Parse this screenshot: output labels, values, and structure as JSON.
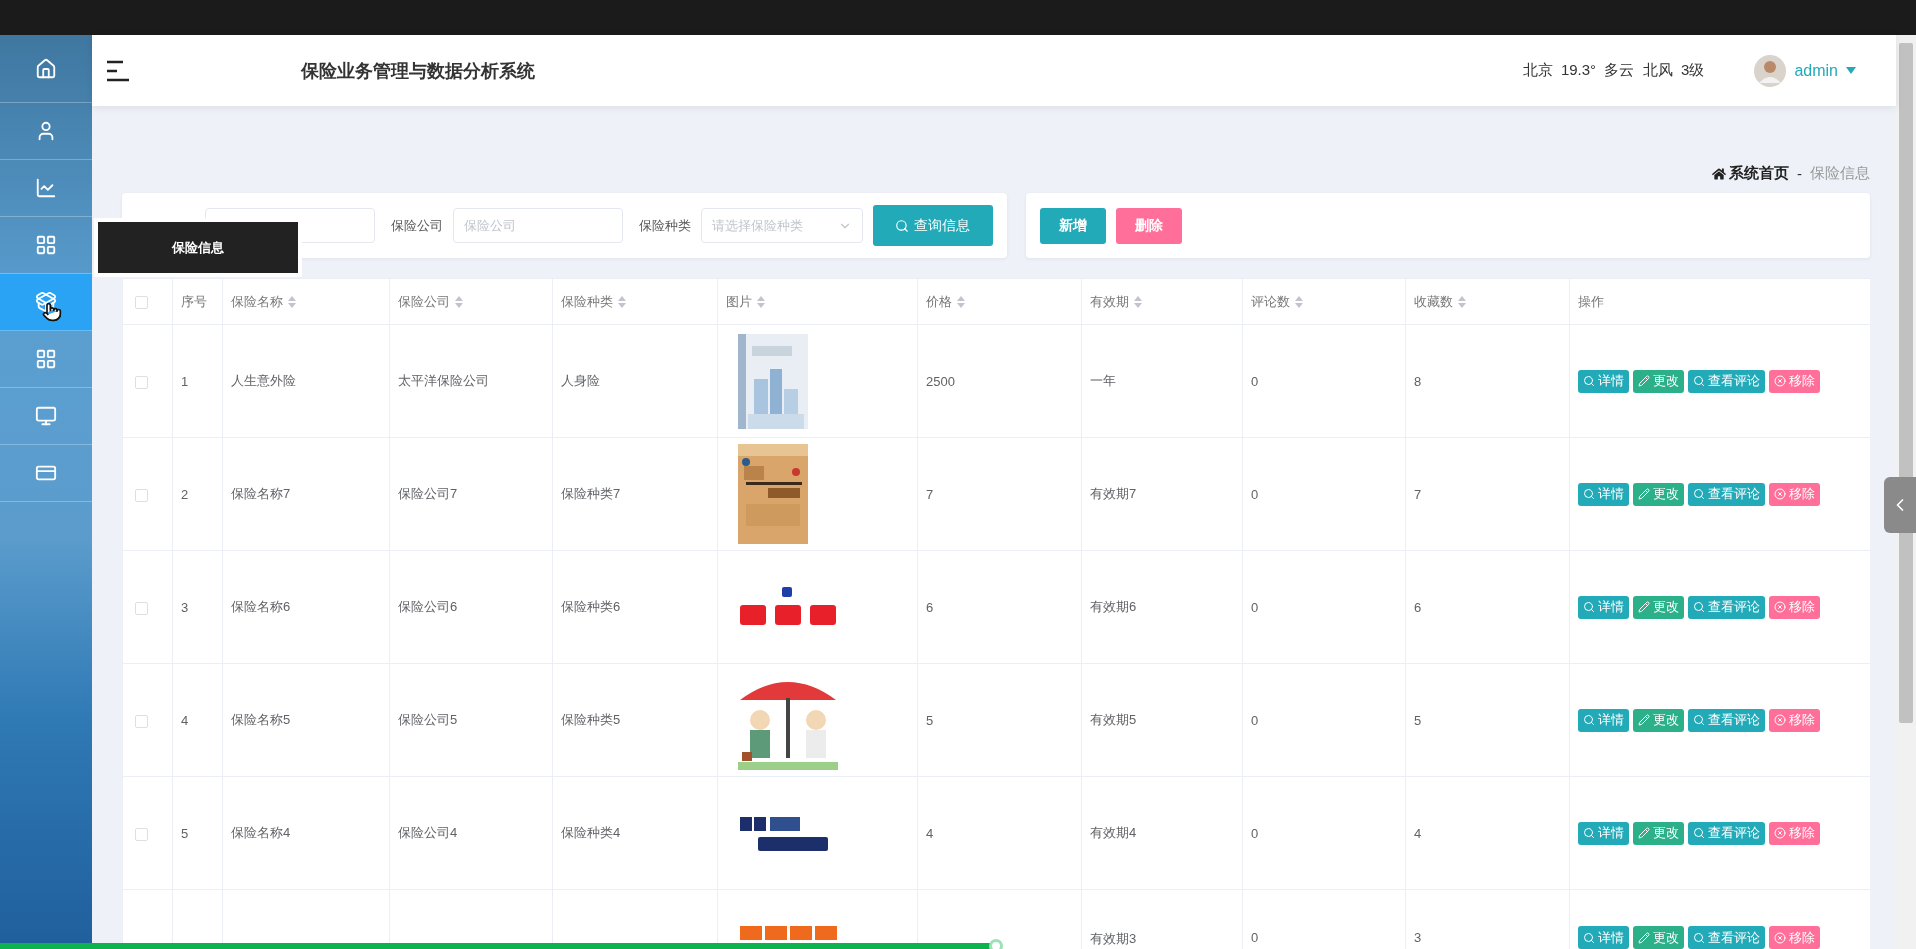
{
  "sidebar": {
    "items": [
      {
        "selected": false
      },
      {
        "selected": false
      },
      {
        "selected": false
      },
      {
        "selected": false
      },
      {
        "selected": true
      },
      {
        "selected": false
      },
      {
        "selected": false
      },
      {
        "selected": false
      }
    ]
  },
  "tooltip": "保险信息",
  "header": {
    "title": "保险业务管理与数据分析系统",
    "weather": "北京  19.3°  多云  北风  3级",
    "user": "admin"
  },
  "breadcrumb": {
    "home": "系统首页",
    "separator": "-",
    "current": "保险信息"
  },
  "search": {
    "fields": [
      {
        "kind": "input"
      },
      {
        "kind": "input",
        "label": "保险公司",
        "placeholder": "保险公司"
      },
      {
        "kind": "select",
        "label": "保险种类",
        "placeholder": "请选择保险种类"
      }
    ],
    "button": "查询信息"
  },
  "actions": [
    {
      "kind": "primary",
      "label": "新增"
    },
    {
      "kind": "danger",
      "label": "删除"
    }
  ],
  "table": {
    "select_all": false,
    "columns": [
      {
        "kind": "text",
        "label": "序号",
        "sortable": false
      },
      {
        "kind": "text",
        "label": "保险名称",
        "sortable": true
      },
      {
        "kind": "text",
        "label": "保险公司",
        "sortable": true
      },
      {
        "kind": "text",
        "label": "保险种类",
        "sortable": true
      },
      {
        "label": "图片",
        "sortable": true
      },
      {
        "kind": "text",
        "label": "价格",
        "sortable": true
      },
      {
        "kind": "text",
        "label": "有效期",
        "sortable": true
      },
      {
        "kind": "text",
        "label": "评论数",
        "sortable": true
      },
      {
        "kind": "text",
        "label": "收藏数",
        "sortable": true
      },
      {
        "kind": "actions",
        "label": "操作",
        "sortable": false
      }
    ],
    "rows": [
      {
        "checked": false,
        "index": "1",
        "name": "人生意外险",
        "company": "太平洋保险公司",
        "type": "人身险",
        "price": "2500",
        "validity": "一年",
        "comments": "0",
        "favorites": "8",
        "actions": [
          {
            "kind": "detail",
            "label": "详情"
          },
          {
            "kind": "edit",
            "label": "更改"
          },
          {
            "kind": "detail",
            "label": "查看评论"
          },
          {
            "kind": "remove",
            "label": "移除"
          }
        ]
      },
      {
        "checked": false,
        "index": "2",
        "name": "保险名称7",
        "company": "保险公司7",
        "type": "保险种类7",
        "price": "7",
        "validity": "有效期7",
        "comments": "0",
        "favorites": "7",
        "actions": [
          {
            "kind": "detail",
            "label": "详情"
          },
          {
            "kind": "edit",
            "label": "更改"
          },
          {
            "kind": "detail",
            "label": "查看评论"
          },
          {
            "kind": "remove",
            "label": "移除"
          }
        ]
      },
      {
        "checked": false,
        "index": "3",
        "name": "保险名称6",
        "company": "保险公司6",
        "type": "保险种类6",
        "price": "6",
        "validity": "有效期6",
        "comments": "0",
        "favorites": "6",
        "actions": [
          {
            "kind": "detail",
            "label": "详情"
          },
          {
            "kind": "edit",
            "label": "更改"
          },
          {
            "kind": "detail",
            "label": "查看评论"
          },
          {
            "kind": "remove",
            "label": "移除"
          }
        ]
      },
      {
        "checked": false,
        "index": "4",
        "name": "保险名称5",
        "company": "保险公司5",
        "type": "保险种类5",
        "price": "5",
        "validity": "有效期5",
        "comments": "0",
        "favorites": "5",
        "actions": [
          {
            "kind": "detail",
            "label": "详情"
          },
          {
            "kind": "edit",
            "label": "更改"
          },
          {
            "kind": "detail",
            "label": "查看评论"
          },
          {
            "kind": "remove",
            "label": "移除"
          }
        ]
      },
      {
        "checked": false,
        "index": "5",
        "name": "保险名称4",
        "company": "保险公司4",
        "type": "保险种类4",
        "price": "4",
        "validity": "有效期4",
        "comments": "0",
        "favorites": "4",
        "actions": [
          {
            "kind": "detail",
            "label": "详情"
          },
          {
            "kind": "edit",
            "label": "更改"
          },
          {
            "kind": "detail",
            "label": "查看评论"
          },
          {
            "kind": "remove",
            "label": "移除"
          }
        ]
      },
      {
        "validity": "有效期3",
        "comments": "0",
        "favorites": "3",
        "actions": [
          {
            "kind": "detail",
            "label": "详情"
          },
          {
            "kind": "edit",
            "label": "更改"
          },
          {
            "kind": "detail",
            "label": "查看评论"
          },
          {
            "kind": "remove",
            "label": "移除"
          }
        ]
      }
    ]
  },
  "progress": {
    "level": 0.52
  }
}
